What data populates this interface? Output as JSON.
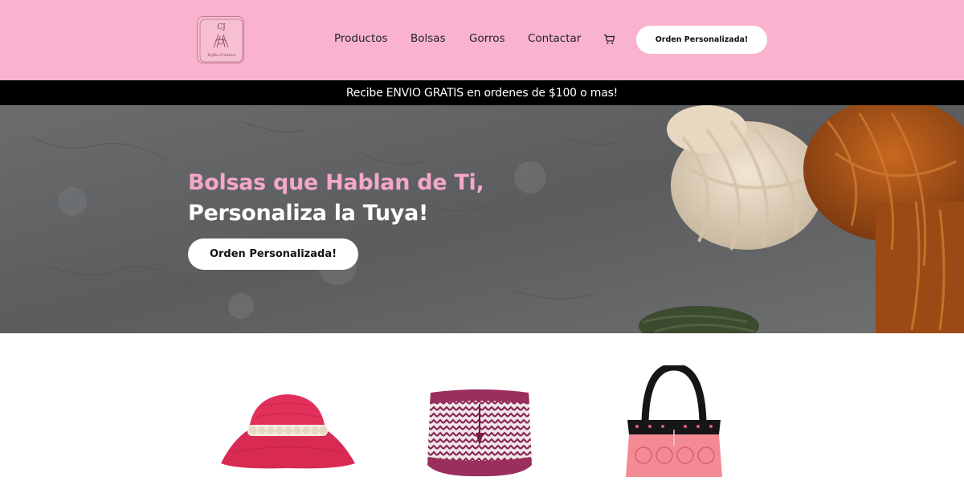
{
  "header": {
    "logo": {
      "initials": "CJ",
      "tagline": "Tejido Creativo"
    },
    "nav": [
      {
        "label": "Productos"
      },
      {
        "label": "Bolsas"
      },
      {
        "label": "Gorros"
      },
      {
        "label": "Contactar"
      }
    ],
    "cart_icon": "cart-icon",
    "cta_label": "Orden Personalizada!",
    "background_color": "#f9b3cf"
  },
  "promo": {
    "text": "Recibe ENVIO GRATIS en ordenes de $100 o mas!"
  },
  "hero": {
    "line1": "Bolsas que Hablan de Ti,",
    "line2": "Personaliza la Tuya!",
    "cta_label": "Orden Personalizada!",
    "accent_color": "#f4a7c8"
  },
  "products": [
    {
      "image": "pink bucket hat with white beaded band"
    },
    {
      "image": "maroon and white striped drawstring bag"
    },
    {
      "image": "black and pink crochet tote bag"
    }
  ]
}
